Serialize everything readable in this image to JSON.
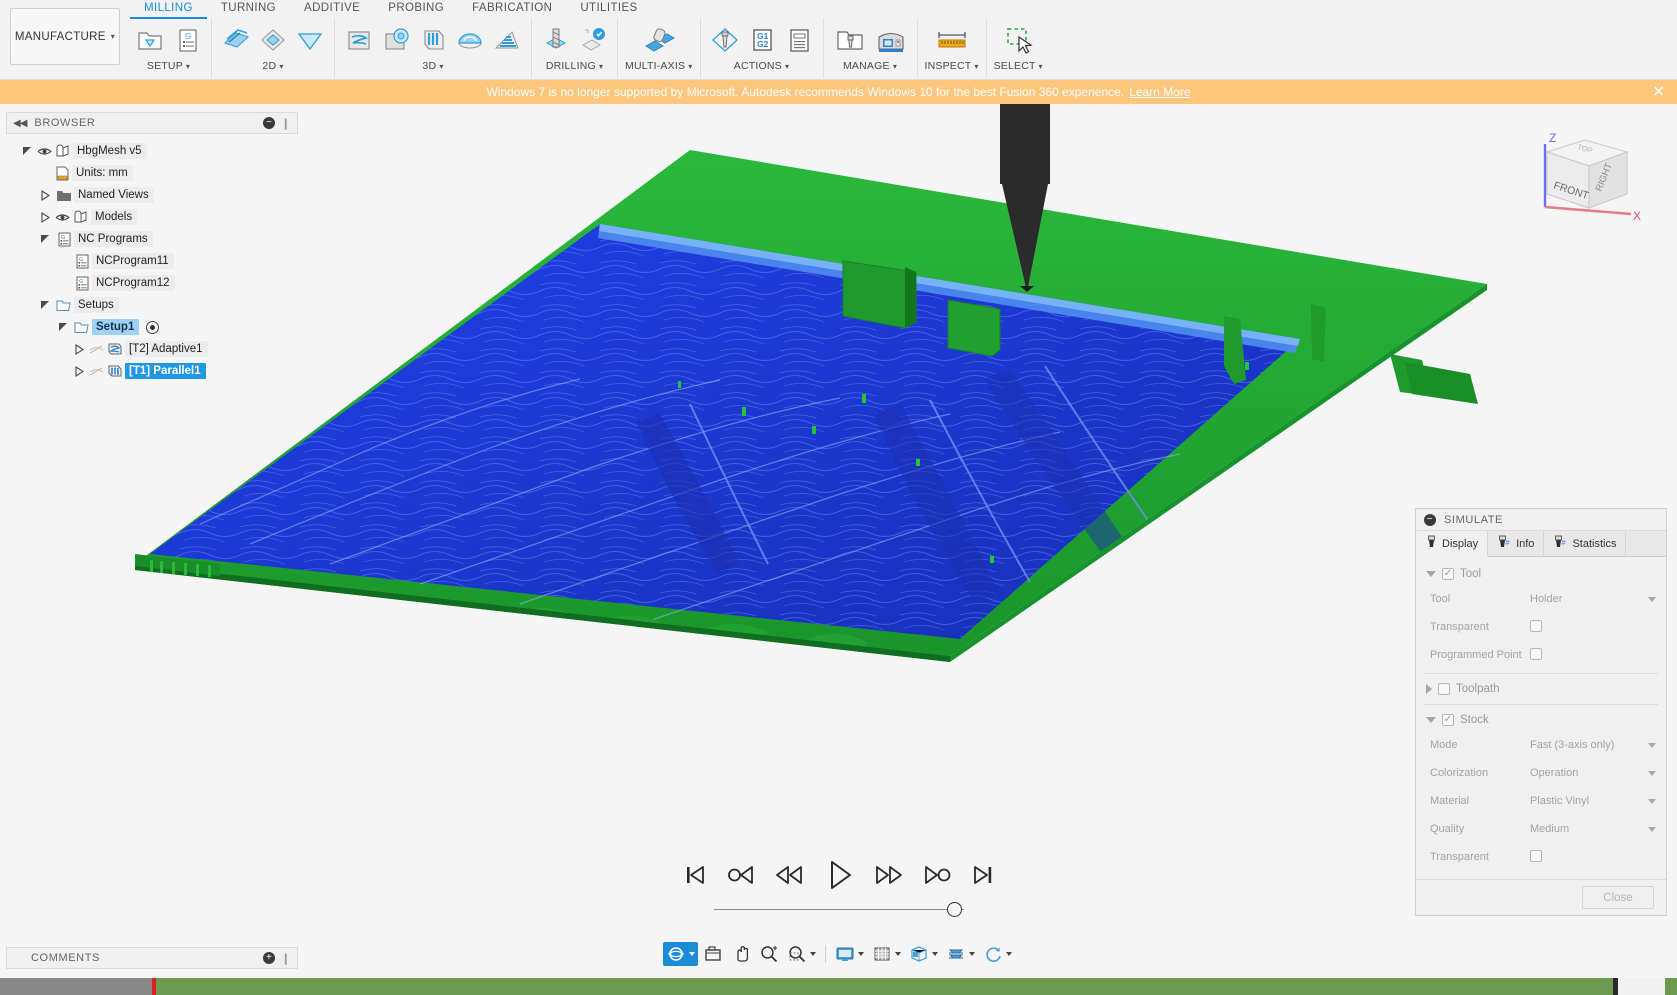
{
  "ribbon": {
    "workspace_button": "MANUFACTURE",
    "tabs": [
      {
        "label": "MILLING",
        "active": true
      },
      {
        "label": "TURNING",
        "active": false
      },
      {
        "label": "ADDITIVE",
        "active": false
      },
      {
        "label": "PROBING",
        "active": false
      },
      {
        "label": "FABRICATION",
        "active": false
      },
      {
        "label": "UTILITIES",
        "active": false
      }
    ],
    "groups": [
      {
        "label": "SETUP",
        "has_caret": true,
        "icons": [
          "new-setup-icon",
          "new-nc-program-icon"
        ]
      },
      {
        "label": "2D",
        "has_caret": true,
        "icons": [
          "face-icon",
          "adaptive-2d-icon",
          "pocket-2d-icon"
        ]
      },
      {
        "label": "3D",
        "has_caret": true,
        "icons": [
          "adaptive-clearing-icon",
          "pocket-clearing-icon",
          "parallel-icon",
          "scallop-icon",
          "spiral-icon"
        ]
      },
      {
        "label": "DRILLING",
        "has_caret": true,
        "icons": [
          "drill-icon",
          "bore-icon"
        ]
      },
      {
        "label": "MULTI-AXIS",
        "has_caret": true,
        "icons": [
          "multi-axis-contour-icon"
        ]
      },
      {
        "label": "ACTIONS",
        "has_caret": true,
        "icons": [
          "simulate-icon",
          "post-process-icon",
          "setup-sheet-icon"
        ]
      },
      {
        "label": "MANAGE",
        "has_caret": true,
        "icons": [
          "tool-library-icon",
          "machine-library-icon"
        ]
      },
      {
        "label": "INSPECT",
        "has_caret": true,
        "icons": [
          "measure-icon"
        ]
      },
      {
        "label": "SELECT",
        "has_caret": true,
        "icons": [
          "select-window-icon"
        ]
      }
    ]
  },
  "banner": {
    "message": "Windows 7 is no longer supported by Microsoft. Autodesk recommends Windows 10 for the best Fusion 360 experience.",
    "link": "Learn More",
    "close": "✕",
    "color": "#fcc77d"
  },
  "browser": {
    "title": "BROWSER",
    "collapse_glyph": "◀◀",
    "minus_glyph": "−",
    "grip_glyph": "❙",
    "tree": [
      {
        "label": "HbgMesh v5",
        "indent": 0,
        "twisty": "open",
        "eye": true,
        "icon": "component-icon",
        "state": "normal"
      },
      {
        "label": "Units: mm",
        "indent": 2,
        "twisty": "none",
        "eye": false,
        "icon": "units-icon",
        "state": "normal"
      },
      {
        "label": "Named Views",
        "indent": 1,
        "twisty": "closed",
        "eye": false,
        "icon": "folder-icon",
        "state": "normal"
      },
      {
        "label": "Models",
        "indent": 1,
        "twisty": "closed",
        "eye": true,
        "icon": "component-icon",
        "state": "normal"
      },
      {
        "label": "NC Programs",
        "indent": 1,
        "twisty": "open",
        "eye": false,
        "icon": "nc-program-icon",
        "state": "normal"
      },
      {
        "label": "NCProgram11",
        "indent": 3,
        "twisty": "none",
        "eye": false,
        "icon": "nc-program-icon",
        "state": "normal"
      },
      {
        "label": "NCProgram12",
        "indent": 3,
        "twisty": "none",
        "eye": false,
        "icon": "nc-program-icon",
        "state": "normal"
      },
      {
        "label": "Setups",
        "indent": 1,
        "twisty": "open",
        "eye": false,
        "icon": "setup-folder-icon",
        "state": "normal"
      },
      {
        "label": "Setup1",
        "indent": 2,
        "twisty": "open",
        "eye": false,
        "icon": "setup-folder-icon",
        "state": "selected-light",
        "radio": true
      },
      {
        "label": "[T2] Adaptive1",
        "indent": 3,
        "twisty": "closed",
        "eye": "dim",
        "icon": "adaptive-op-icon",
        "state": "normal"
      },
      {
        "label": "[T1] Parallel1",
        "indent": 3,
        "twisty": "closed",
        "eye": "dim",
        "icon": "parallel-op-icon",
        "state": "selected"
      }
    ]
  },
  "comments": {
    "title": "COMMENTS",
    "add_glyph": "＋",
    "grip_glyph": "❙"
  },
  "viewcube": {
    "front_face": "FRONT",
    "right_face": "RIGHT",
    "top_face": "TOP",
    "axis_z": "Z",
    "axis_x": "X"
  },
  "simulate": {
    "title": "SIMULATE",
    "minus_glyph": "−",
    "tabs": [
      {
        "label": "Display",
        "icon": "tool-display-icon",
        "active": true
      },
      {
        "label": "Info",
        "icon": "tool-info-icon",
        "active": false
      },
      {
        "label": "Statistics",
        "icon": "tool-statistics-icon",
        "active": false
      }
    ],
    "sections": [
      {
        "name": "Tool",
        "expanded": true,
        "checked": true,
        "rows": [
          {
            "label": "Tool",
            "value": "Holder",
            "type": "dropdown"
          },
          {
            "label": "Transparent",
            "value": "",
            "type": "checkbox",
            "checked": false
          },
          {
            "label": "Programmed Point",
            "value": "",
            "type": "checkbox",
            "checked": false
          }
        ]
      },
      {
        "name": "Toolpath",
        "expanded": false,
        "checked": false,
        "rows": []
      },
      {
        "name": "Stock",
        "expanded": true,
        "checked": true,
        "rows": [
          {
            "label": "Mode",
            "value": "Fast (3-axis only)",
            "type": "dropdown"
          },
          {
            "label": "Colorization",
            "value": "Operation",
            "type": "dropdown"
          },
          {
            "label": "Material",
            "value": "Plastic Vinyl",
            "type": "dropdown"
          },
          {
            "label": "Quality",
            "value": "Medium",
            "type": "dropdown"
          },
          {
            "label": "Transparent",
            "value": "",
            "type": "checkbox",
            "checked": false
          }
        ]
      }
    ],
    "close_label": "Close"
  },
  "playback": {
    "buttons": [
      {
        "name": "skip-to-start-button",
        "glyph": "start"
      },
      {
        "name": "step-back-operation-button",
        "glyph": "prev-op"
      },
      {
        "name": "rewind-button",
        "glyph": "rewind"
      },
      {
        "name": "play-button",
        "glyph": "play"
      },
      {
        "name": "fast-forward-button",
        "glyph": "ffwd"
      },
      {
        "name": "step-forward-operation-button",
        "glyph": "next-op"
      },
      {
        "name": "skip-to-end-button",
        "glyph": "end"
      }
    ],
    "slider_percent": 96
  },
  "navbar": {
    "items": [
      {
        "name": "orbit-button",
        "icon": "orbit-icon",
        "caret": true,
        "active": true
      },
      {
        "name": "look-at-button",
        "icon": "look-at-icon",
        "caret": false,
        "active": false
      },
      {
        "name": "pan-button",
        "icon": "pan-icon",
        "caret": false,
        "active": false
      },
      {
        "name": "zoom-button",
        "icon": "zoom-icon",
        "caret": false,
        "active": false
      },
      {
        "name": "zoom-window-button",
        "icon": "zoom-window-icon",
        "caret": true,
        "active": false
      },
      {
        "name": "display-settings-button",
        "icon": "display-settings-icon",
        "caret": true,
        "active": false
      },
      {
        "name": "grid-snaps-button",
        "icon": "grid-icon",
        "caret": true,
        "active": false
      },
      {
        "name": "viewports-button",
        "icon": "viewports-icon",
        "caret": true,
        "active": false
      },
      {
        "name": "object-visibility-button",
        "icon": "layers-icon",
        "caret": true,
        "active": false
      },
      {
        "name": "refresh-button",
        "icon": "refresh-icon",
        "caret": true,
        "active": false
      }
    ]
  },
  "timeline": {
    "gray_label": "",
    "colors": {
      "gray": "#878787",
      "marker": "#e02020",
      "green": "#6d9950",
      "dark": "#2a2a2a"
    }
  },
  "scene": {
    "stock_color": "#21a134",
    "machined_color": "#1f3fdc",
    "tool_color": "#262626",
    "description": "3D CNC simulation of a machined terrain relief model"
  }
}
